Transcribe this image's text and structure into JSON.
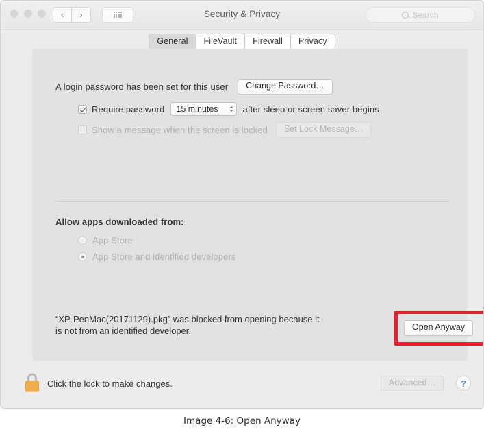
{
  "window": {
    "title": "Security & Privacy",
    "traffic_lights": [
      "close",
      "minimize",
      "zoom"
    ],
    "toolbar": {
      "back_label": "‹",
      "forward_label": "›",
      "grid_label": "show-all",
      "search_placeholder": "Search"
    },
    "tabs": [
      {
        "label": "General",
        "selected": true
      },
      {
        "label": "FileVault",
        "selected": false
      },
      {
        "label": "Firewall",
        "selected": false
      },
      {
        "label": "Privacy",
        "selected": false
      }
    ]
  },
  "general": {
    "login_password_text": "A login password has been set for this user",
    "change_password_button": "Change Password…",
    "require_password": {
      "checked": true,
      "prefix": "Require password",
      "interval_value": "15 minutes",
      "suffix": "after sleep or screen saver begins"
    },
    "lock_message": {
      "checked": false,
      "label": "Show a message when the screen is locked",
      "button": "Set Lock Message…",
      "disabled": true
    },
    "allow_apps": {
      "heading": "Allow apps downloaded from:",
      "options": [
        {
          "label": "App Store",
          "selected": false
        },
        {
          "label": "App Store and identified developers",
          "selected": true
        }
      ],
      "disabled": true
    },
    "blocked_notice": {
      "line1": "“XP-PenMac(20171129).pkg” was blocked from opening because it",
      "line2": "is not from an identified developer.",
      "filename": "XP-PenMac(20171129).pkg"
    },
    "open_anyway_button": "Open Anyway"
  },
  "bottom_bar": {
    "lock_icon": "lock-closed-icon",
    "lock_text": "Click the lock to make changes.",
    "advanced_button": "Advanced…",
    "advanced_disabled": true,
    "help_button": "?"
  },
  "annotation": {
    "color": "#ee1c2e",
    "target": "Open Anyway"
  },
  "caption": "Image 4-6: Open Anyway"
}
